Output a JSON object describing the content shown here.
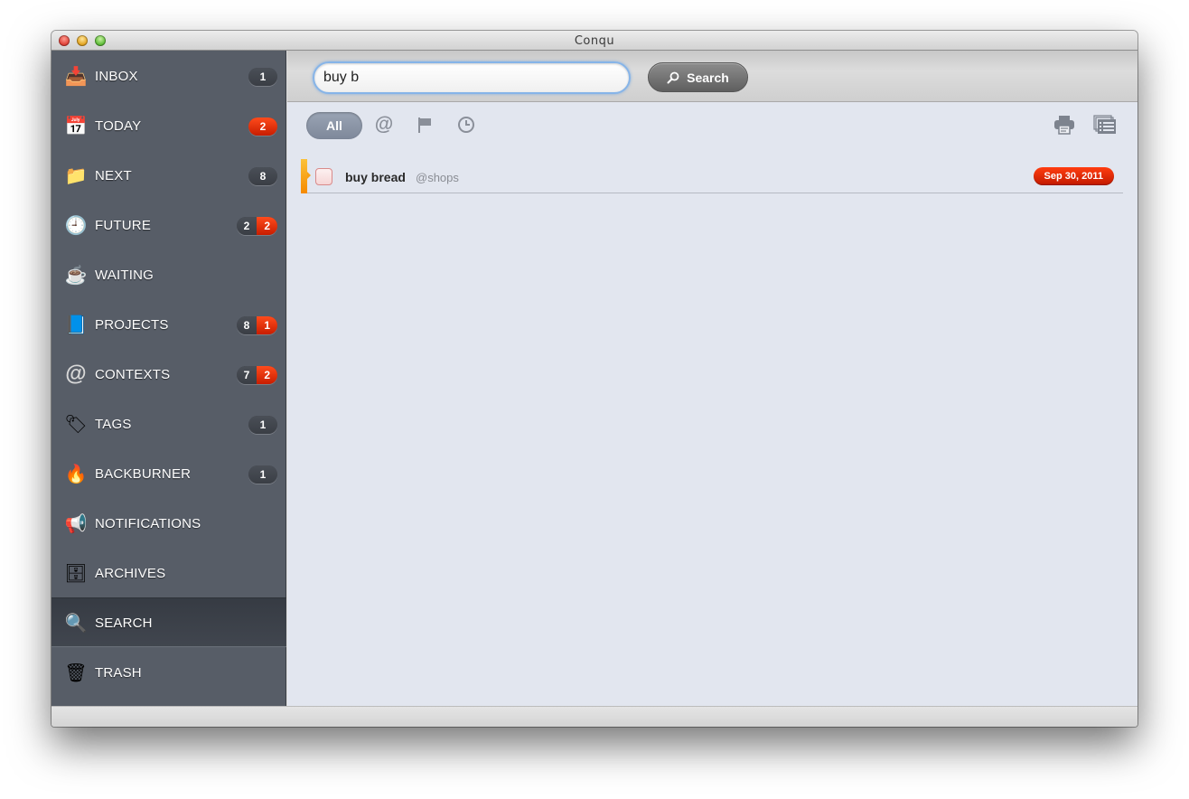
{
  "window": {
    "title": "Conqu"
  },
  "sidebar": {
    "items": [
      {
        "id": "inbox",
        "label": "INBOX",
        "icon": "inbox-tray-icon",
        "glyph": "📥",
        "badges": [
          {
            "value": "1",
            "color": "gray"
          }
        ]
      },
      {
        "id": "today",
        "label": "TODAY",
        "icon": "calendar-17-icon",
        "glyph": "📅",
        "badges": [
          {
            "value": "2",
            "color": "red"
          }
        ]
      },
      {
        "id": "next",
        "label": "NEXT",
        "icon": "folder-bookmark-icon",
        "glyph": "📁",
        "badges": [
          {
            "value": "8",
            "color": "gray"
          }
        ]
      },
      {
        "id": "future",
        "label": "FUTURE",
        "icon": "clock-icon",
        "glyph": "🕘",
        "badges": [
          {
            "value": "2",
            "color": "gray"
          },
          {
            "value": "2",
            "color": "red"
          }
        ]
      },
      {
        "id": "waiting",
        "label": "WAITING",
        "icon": "coffee-mug-icon",
        "glyph": "☕",
        "badges": []
      },
      {
        "id": "projects",
        "label": "PROJECTS",
        "icon": "project-book-icon",
        "glyph": "📘",
        "badges": [
          {
            "value": "8",
            "color": "gray"
          },
          {
            "value": "1",
            "color": "red"
          }
        ]
      },
      {
        "id": "contexts",
        "label": "CONTEXTS",
        "icon": "at-sign-icon",
        "glyph": "@",
        "badges": [
          {
            "value": "7",
            "color": "gray"
          },
          {
            "value": "2",
            "color": "red"
          }
        ]
      },
      {
        "id": "tags",
        "label": "TAGS",
        "icon": "tags-icon",
        "glyph": "🏷",
        "badges": [
          {
            "value": "1",
            "color": "gray"
          }
        ]
      },
      {
        "id": "backburner",
        "label": "BACKBURNER",
        "icon": "flame-icon",
        "glyph": "🔥",
        "badges": [
          {
            "value": "1",
            "color": "gray"
          }
        ]
      },
      {
        "id": "notifications",
        "label": "NOTIFICATIONS",
        "icon": "megaphone-icon",
        "glyph": "📢",
        "badges": []
      },
      {
        "id": "archives",
        "label": "ARCHIVES",
        "icon": "archive-drawer-icon",
        "glyph": "🗄",
        "badges": []
      },
      {
        "id": "search",
        "label": "SEARCH",
        "icon": "magnifier-icon",
        "glyph": "🔍",
        "badges": [],
        "active": true
      },
      {
        "id": "trash",
        "label": "TRASH",
        "icon": "trash-can-icon",
        "glyph": "🗑",
        "badges": []
      }
    ]
  },
  "toolbar": {
    "search_value": "buy b",
    "search_placeholder": "",
    "search_button_label": "Search"
  },
  "filters": {
    "all_label": "All",
    "at_label": "@",
    "items": [
      "all",
      "context",
      "flag",
      "due-date"
    ]
  },
  "tasks": [
    {
      "title": "buy bread",
      "context": "@shops",
      "due_date": "Sep 30, 2011",
      "priority_color": "#f7a11a",
      "completed": false
    }
  ],
  "colors": {
    "sidebar_bg": "#575d67",
    "main_bg": "#e2e6ef",
    "badge_red": "#e02a05",
    "badge_gray": "#40444b",
    "search_focus": "#86b4e8"
  }
}
